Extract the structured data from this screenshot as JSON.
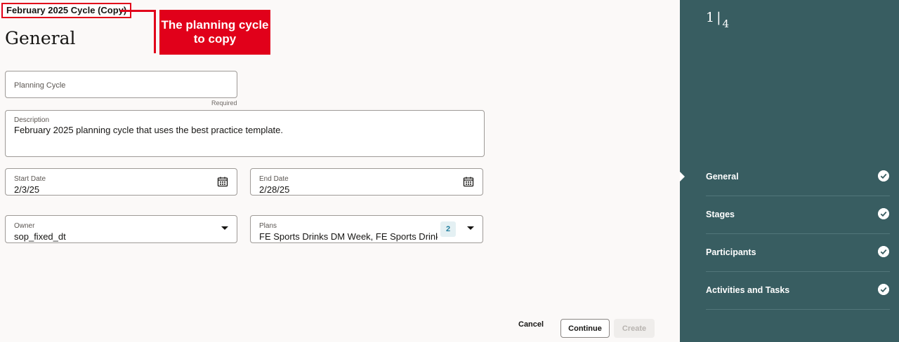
{
  "header": {
    "cycle_title": "February 2025 Cycle (Copy)",
    "callout": "The planning cycle to copy",
    "page_title": "General"
  },
  "form": {
    "planning_cycle": {
      "placeholder": "Planning Cycle",
      "helper": "Required",
      "value": ""
    },
    "description": {
      "label": "Description",
      "value": "February 2025 planning cycle that uses the best practice template."
    },
    "start_date": {
      "label": "Start Date",
      "value": "2/3/25",
      "icon": "calendar-icon"
    },
    "end_date": {
      "label": "End Date",
      "value": "2/28/25",
      "icon": "calendar-icon"
    },
    "owner": {
      "label": "Owner",
      "value": "sop_fixed_dt",
      "icon": "chevron-down-icon"
    },
    "plans": {
      "label": "Plans",
      "value": "FE Sports Drinks DM Week, FE Sports Drinks S",
      "count": "2",
      "icon": "chevron-down-icon"
    }
  },
  "footer": {
    "cancel": "Cancel",
    "continue": "Continue",
    "create": "Create"
  },
  "sidebar": {
    "current_step": "1",
    "total_steps": "4",
    "steps": [
      {
        "label": "General",
        "completed": true,
        "active": true
      },
      {
        "label": "Stages",
        "completed": true,
        "active": false
      },
      {
        "label": "Participants",
        "completed": true,
        "active": false
      },
      {
        "label": "Activities and Tasks",
        "completed": true,
        "active": false
      }
    ]
  },
  "colors": {
    "sidebar_bg": "#385d61",
    "callout_red": "#e1001a",
    "badge_text": "#227e9e"
  }
}
